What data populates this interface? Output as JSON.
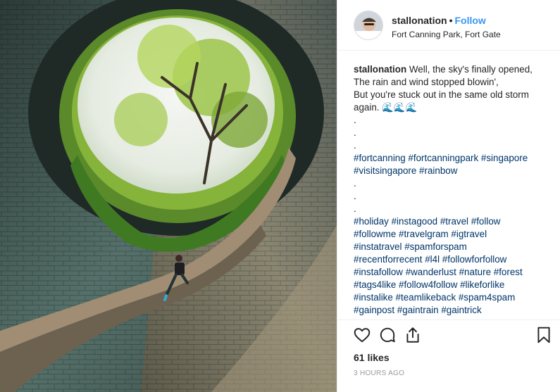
{
  "post": {
    "username": "stallonation",
    "separator": "•",
    "follow_label": "Follow",
    "location": "Fort Canning Park, Fort Gate",
    "caption_lines": [
      "Well, the sky's finally opened,",
      "The rain and wind stopped blowin',",
      "But you're stuck out in the same old storm",
      "again. 🌊🌊🌊",
      ".",
      ".",
      ".",
      "#fortcanning #fortcanningpark #singapore",
      "#visitsingapore #rainbow",
      ".",
      ".",
      ".",
      "#holiday #instagood #travel #follow",
      "#followme #travelgram #igtravel",
      "#instatravel #spamforspam",
      "#recentforrecent #l4l #followforfollow",
      "#instafollow #wanderlust #nature #forest",
      "#tags4like #follow4follow #likeforlike",
      "#instalike #teamlikeback #spam4spam",
      "#gainpost #gaintrain #gaintrick"
    ],
    "likes": "61 likes",
    "timestamp": "3 HOURS AGO"
  },
  "icons": {
    "like": "heart-icon",
    "comment": "comment-icon",
    "share": "share-icon",
    "save": "bookmark-icon"
  },
  "colors": {
    "link": "#3897f0",
    "hashtag": "#003569",
    "muted": "#999999",
    "border": "#efefef"
  }
}
